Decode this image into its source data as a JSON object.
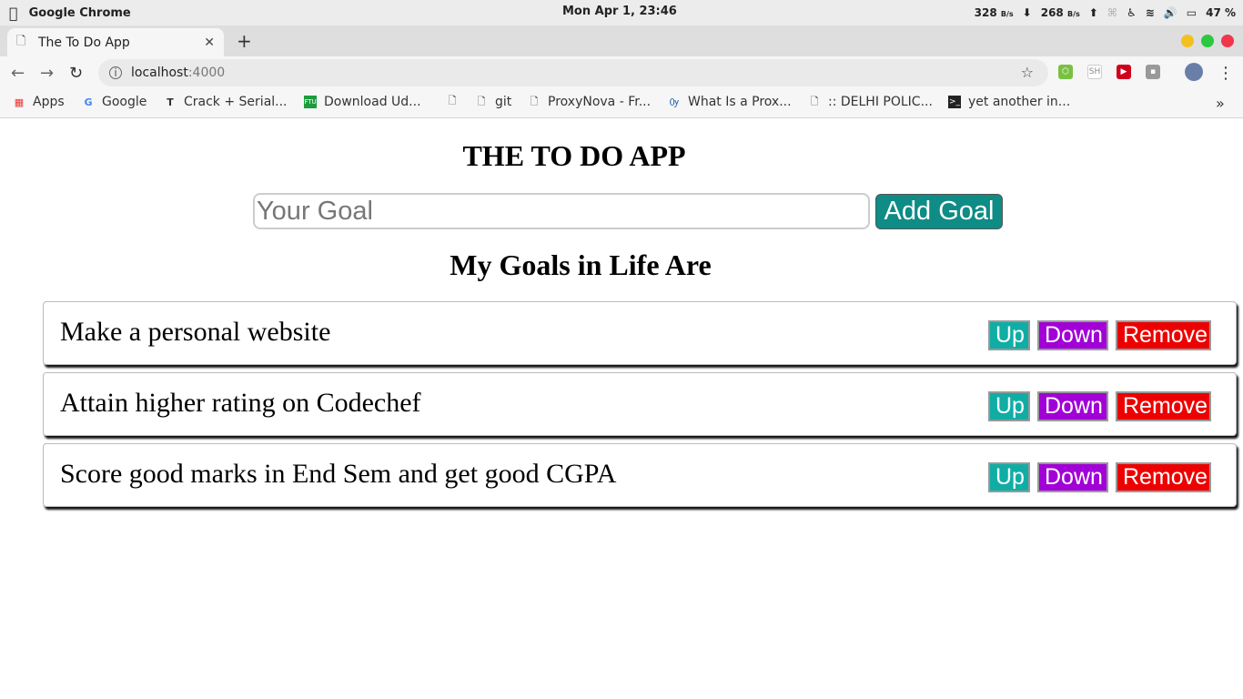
{
  "os": {
    "app_name": "Google Chrome",
    "datetime": "Mon Apr  1, 23:46",
    "down_speed": "328",
    "down_unit": "B/s",
    "up_speed": "268",
    "up_unit": "B/s",
    "battery": "47 %"
  },
  "browser": {
    "tab_title": "The To Do App",
    "url_host": "localhost",
    "url_port": ":4000",
    "bookmarks": [
      {
        "label": "Apps"
      },
      {
        "label": "Google"
      },
      {
        "label": "Crack + Serial..."
      },
      {
        "label": "Download Ud..."
      },
      {
        "label": ""
      },
      {
        "label": "git"
      },
      {
        "label": "ProxyNova - Fr..."
      },
      {
        "label": "What Is a Prox..."
      },
      {
        "label": ":: DELHI POLIC..."
      },
      {
        "label": "yet another in..."
      }
    ],
    "more_label": "»"
  },
  "app": {
    "title": "THE TO DO APP",
    "input_placeholder": "Your Goal",
    "add_button": "Add Goal",
    "list_heading": "My Goals in Life Are",
    "goals": [
      {
        "text": "Make a personal website",
        "up": "Up",
        "down": "Down",
        "remove": "Remove"
      },
      {
        "text": "Attain higher rating on Codechef",
        "up": "Up",
        "down": "Down",
        "remove": "Remove"
      },
      {
        "text": "Score good marks in End Sem and get good CGPA",
        "up": "Up",
        "down": "Down",
        "remove": "Remove"
      }
    ]
  },
  "colors": {
    "add_button": "#0e8c85",
    "up_button": "#10ada5",
    "down_button": "#a100d6",
    "remove_button": "#ed0000"
  }
}
